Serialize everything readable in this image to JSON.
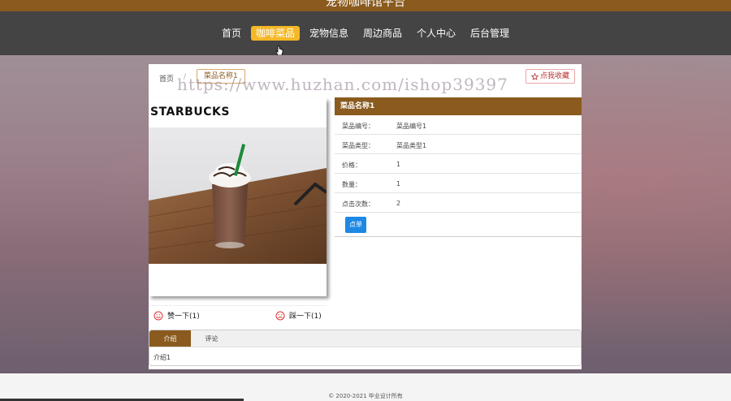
{
  "header": {
    "site_title": "宠物咖啡馆平台"
  },
  "nav": {
    "items": [
      {
        "label": "首页"
      },
      {
        "label": "咖啡菜品",
        "active": true
      },
      {
        "label": "宠物信息"
      },
      {
        "label": "周边商品"
      },
      {
        "label": "个人中心"
      },
      {
        "label": "后台管理"
      }
    ]
  },
  "breadcrumb": {
    "home": "首页",
    "separator": "/",
    "current": "菜品名称1"
  },
  "favorite_label": "点我收藏",
  "watermark": "https://www.huzhan.com/ishop39397",
  "product": {
    "brand": "STARBUCKS",
    "name": "菜品名称1",
    "fields": [
      {
        "label": "菜品编号：",
        "value": "菜品编号1"
      },
      {
        "label": "菜品类型：",
        "value": "菜品类型1"
      },
      {
        "label": "价格：",
        "value": "1"
      },
      {
        "label": "数量：",
        "value": "1"
      },
      {
        "label": "点击次数：",
        "value": "2"
      }
    ],
    "order_label": "点单"
  },
  "votes": {
    "up_label": "赞一下(1)",
    "down_label": "踩一下(1)"
  },
  "tabs": {
    "items": [
      {
        "label": "介绍",
        "active": true
      },
      {
        "label": "评论"
      }
    ],
    "content": "介绍1"
  },
  "footer": {
    "copyright": "© 2020-2021 毕业设计所有"
  },
  "colors": {
    "brand": "#8a5a1e",
    "nav_active": "#f5b825",
    "button": "#1e88e5",
    "navbar": "#444444"
  }
}
